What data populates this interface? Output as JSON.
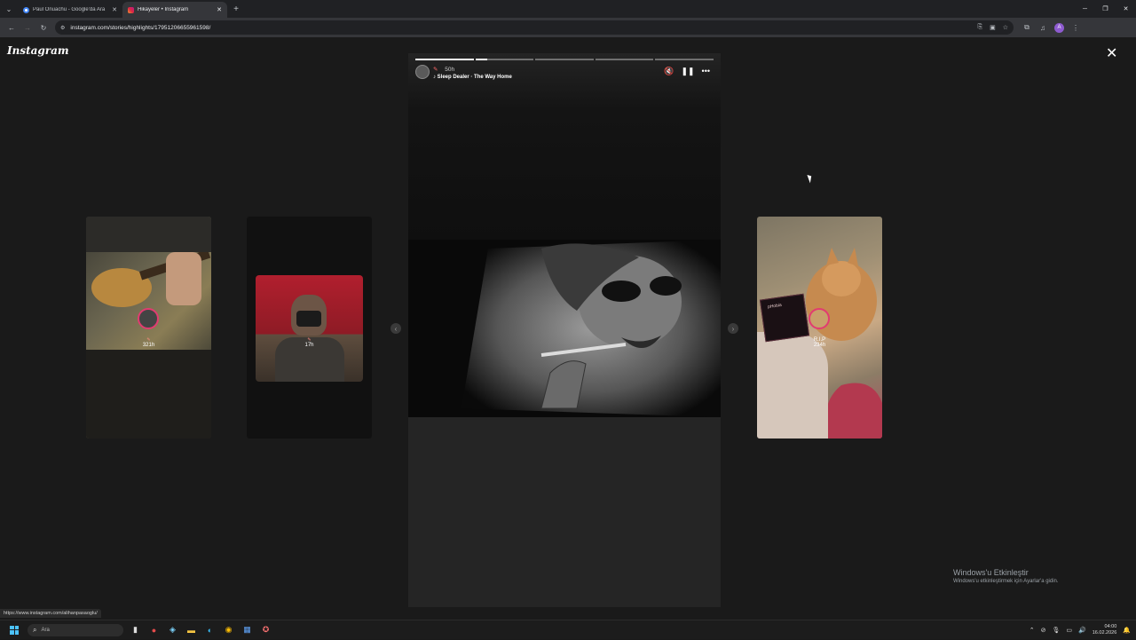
{
  "browser": {
    "tabs": [
      {
        "title": "Paul Onuachu - Google'da Ara",
        "active": false,
        "favicon": "google-icon"
      },
      {
        "title": "Hikayeler • Instagram",
        "active": true,
        "favicon": "instagram-icon"
      }
    ],
    "url": "instagram.com/stories/highlights/17951206655961598/"
  },
  "instagram": {
    "logo": "Instagram",
    "story": {
      "time": "50h",
      "song": "Sleep Dealer · The Way Home",
      "progress_segments": 5,
      "current_segment": 2
    },
    "cards": [
      {
        "label": "321h"
      },
      {
        "label": "17h"
      },
      {
        "name": "R.I.P",
        "label": "234h",
        "album_text": "pHobia"
      }
    ]
  },
  "status_url": "https://www.instagram.com/alihanpasaoglu/",
  "watermark": {
    "line1": "Windows'u Etkinleştir",
    "line2": "Windows'u etkinleştirmek için Ayarlar'a gidin."
  },
  "taskbar": {
    "search_placeholder": "Ara",
    "time": "04:00",
    "date": "16.02.2026"
  }
}
